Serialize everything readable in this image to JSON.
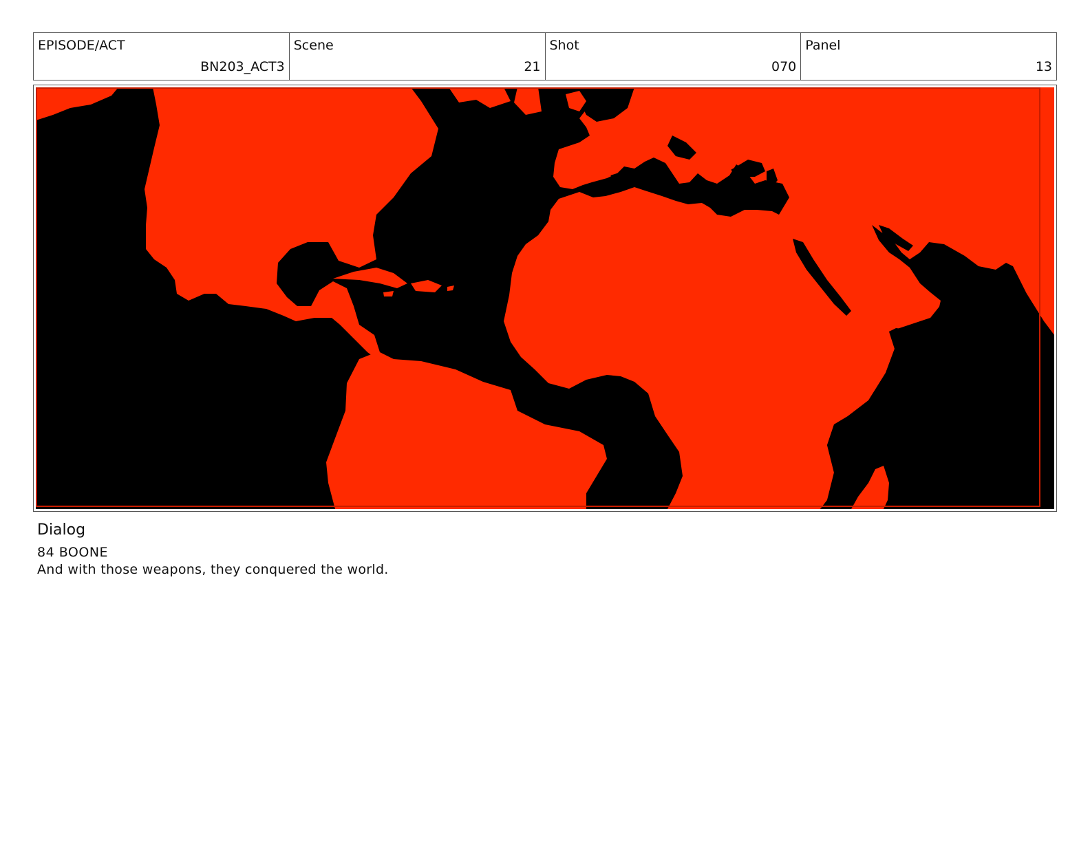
{
  "header": {
    "episode_act": {
      "label": "EPISODE/ACT",
      "value": "BN203_ACT3"
    },
    "scene": {
      "label": "Scene",
      "value": "21"
    },
    "shot": {
      "label": "Shot",
      "value": "070"
    },
    "panel": {
      "label": "Panel",
      "value": "13"
    }
  },
  "panel_image": {
    "land_color": "#ff2a00",
    "water_color": "#000000"
  },
  "dialog": {
    "heading": "Dialog",
    "speaker": "84 BOONE",
    "line": "And with those weapons, they conquered the world."
  }
}
